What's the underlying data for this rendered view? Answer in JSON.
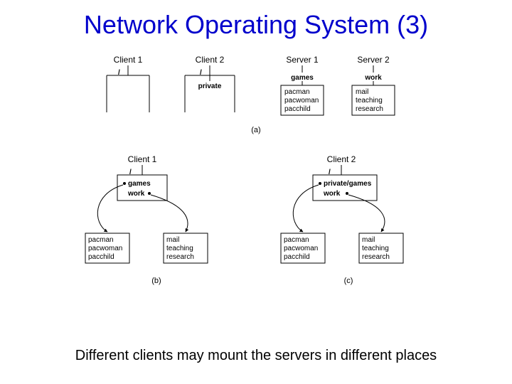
{
  "title": "Network Operating System (3)",
  "caption": "Different clients may mount the servers in different places",
  "sections": {
    "a": "(a)",
    "b": "(b)",
    "c": "(c)"
  },
  "top": {
    "client1": {
      "header": "Client 1",
      "root": "/"
    },
    "client2": {
      "header": "Client 2",
      "root": "/",
      "item": "private"
    },
    "server1": {
      "header": "Server 1",
      "dir": "games",
      "i1": "pacman",
      "i2": "pacwoman",
      "i3": "pacchild"
    },
    "server2": {
      "header": "Server 2",
      "dir": "work",
      "i1": "mail",
      "i2": "teaching",
      "i3": "research"
    }
  },
  "left": {
    "header": "Client 1",
    "root": "/",
    "m1": "games",
    "m2": "work",
    "boxA": {
      "i1": "pacman",
      "i2": "pacwoman",
      "i3": "pacchild"
    },
    "boxB": {
      "i1": "mail",
      "i2": "teaching",
      "i3": "research"
    }
  },
  "right": {
    "header": "Client 2",
    "root": "/",
    "m1": "private/games",
    "m2": "work",
    "boxA": {
      "i1": "pacman",
      "i2": "pacwoman",
      "i3": "pacchild"
    },
    "boxB": {
      "i1": "mail",
      "i2": "teaching",
      "i3": "research"
    }
  }
}
